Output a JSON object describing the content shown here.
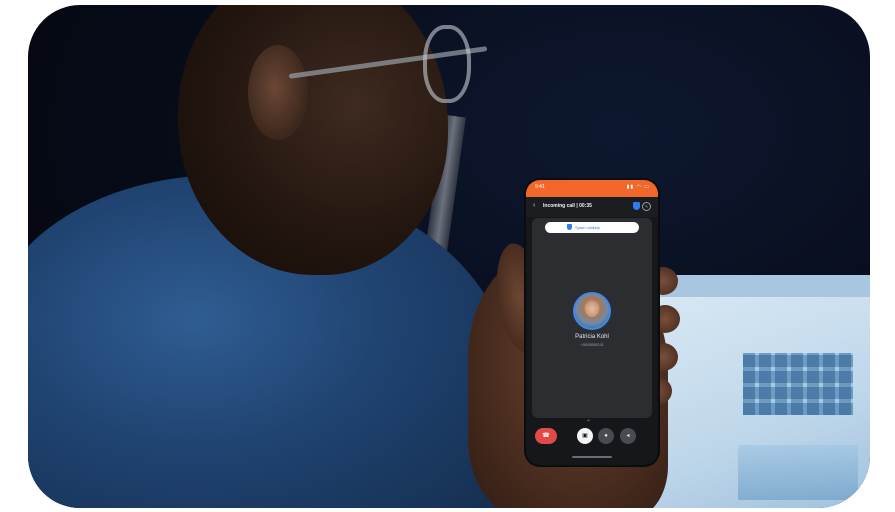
{
  "phone": {
    "status_time": "9:41",
    "status_icons": "▮▮ ◠ ▭",
    "call_title": "Incoming call | 00:35",
    "spam_label": "Spam unlikely",
    "caller_name": "Patricia Kohl",
    "caller_number": "+18005550101",
    "colors": {
      "status_bar": "#f2672a",
      "shield": "#2f7bf0",
      "end_call": "#e24a4a"
    },
    "icons": {
      "back": "‹",
      "edit": "✎",
      "chevron": "⌃",
      "end_call": "☎",
      "video": "▣",
      "mic": "●",
      "speaker": "◂"
    }
  }
}
